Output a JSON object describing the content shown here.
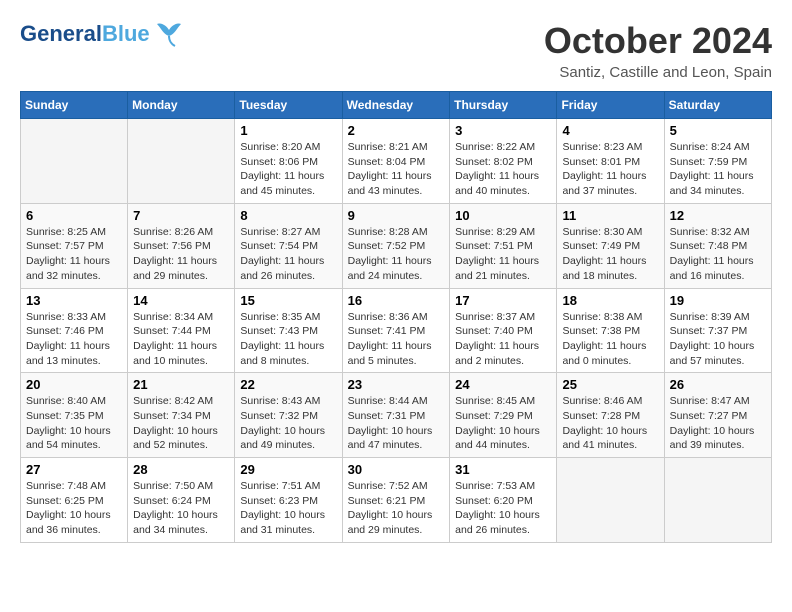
{
  "header": {
    "logo_line1": "General",
    "logo_line2": "Blue",
    "month_title": "October 2024",
    "subtitle": "Santiz, Castille and Leon, Spain"
  },
  "days_of_week": [
    "Sunday",
    "Monday",
    "Tuesday",
    "Wednesday",
    "Thursday",
    "Friday",
    "Saturday"
  ],
  "weeks": [
    [
      {
        "day": "",
        "info": ""
      },
      {
        "day": "",
        "info": ""
      },
      {
        "day": "1",
        "info": "Sunrise: 8:20 AM\nSunset: 8:06 PM\nDaylight: 11 hours and 45 minutes."
      },
      {
        "day": "2",
        "info": "Sunrise: 8:21 AM\nSunset: 8:04 PM\nDaylight: 11 hours and 43 minutes."
      },
      {
        "day": "3",
        "info": "Sunrise: 8:22 AM\nSunset: 8:02 PM\nDaylight: 11 hours and 40 minutes."
      },
      {
        "day": "4",
        "info": "Sunrise: 8:23 AM\nSunset: 8:01 PM\nDaylight: 11 hours and 37 minutes."
      },
      {
        "day": "5",
        "info": "Sunrise: 8:24 AM\nSunset: 7:59 PM\nDaylight: 11 hours and 34 minutes."
      }
    ],
    [
      {
        "day": "6",
        "info": "Sunrise: 8:25 AM\nSunset: 7:57 PM\nDaylight: 11 hours and 32 minutes."
      },
      {
        "day": "7",
        "info": "Sunrise: 8:26 AM\nSunset: 7:56 PM\nDaylight: 11 hours and 29 minutes."
      },
      {
        "day": "8",
        "info": "Sunrise: 8:27 AM\nSunset: 7:54 PM\nDaylight: 11 hours and 26 minutes."
      },
      {
        "day": "9",
        "info": "Sunrise: 8:28 AM\nSunset: 7:52 PM\nDaylight: 11 hours and 24 minutes."
      },
      {
        "day": "10",
        "info": "Sunrise: 8:29 AM\nSunset: 7:51 PM\nDaylight: 11 hours and 21 minutes."
      },
      {
        "day": "11",
        "info": "Sunrise: 8:30 AM\nSunset: 7:49 PM\nDaylight: 11 hours and 18 minutes."
      },
      {
        "day": "12",
        "info": "Sunrise: 8:32 AM\nSunset: 7:48 PM\nDaylight: 11 hours and 16 minutes."
      }
    ],
    [
      {
        "day": "13",
        "info": "Sunrise: 8:33 AM\nSunset: 7:46 PM\nDaylight: 11 hours and 13 minutes."
      },
      {
        "day": "14",
        "info": "Sunrise: 8:34 AM\nSunset: 7:44 PM\nDaylight: 11 hours and 10 minutes."
      },
      {
        "day": "15",
        "info": "Sunrise: 8:35 AM\nSunset: 7:43 PM\nDaylight: 11 hours and 8 minutes."
      },
      {
        "day": "16",
        "info": "Sunrise: 8:36 AM\nSunset: 7:41 PM\nDaylight: 11 hours and 5 minutes."
      },
      {
        "day": "17",
        "info": "Sunrise: 8:37 AM\nSunset: 7:40 PM\nDaylight: 11 hours and 2 minutes."
      },
      {
        "day": "18",
        "info": "Sunrise: 8:38 AM\nSunset: 7:38 PM\nDaylight: 11 hours and 0 minutes."
      },
      {
        "day": "19",
        "info": "Sunrise: 8:39 AM\nSunset: 7:37 PM\nDaylight: 10 hours and 57 minutes."
      }
    ],
    [
      {
        "day": "20",
        "info": "Sunrise: 8:40 AM\nSunset: 7:35 PM\nDaylight: 10 hours and 54 minutes."
      },
      {
        "day": "21",
        "info": "Sunrise: 8:42 AM\nSunset: 7:34 PM\nDaylight: 10 hours and 52 minutes."
      },
      {
        "day": "22",
        "info": "Sunrise: 8:43 AM\nSunset: 7:32 PM\nDaylight: 10 hours and 49 minutes."
      },
      {
        "day": "23",
        "info": "Sunrise: 8:44 AM\nSunset: 7:31 PM\nDaylight: 10 hours and 47 minutes."
      },
      {
        "day": "24",
        "info": "Sunrise: 8:45 AM\nSunset: 7:29 PM\nDaylight: 10 hours and 44 minutes."
      },
      {
        "day": "25",
        "info": "Sunrise: 8:46 AM\nSunset: 7:28 PM\nDaylight: 10 hours and 41 minutes."
      },
      {
        "day": "26",
        "info": "Sunrise: 8:47 AM\nSunset: 7:27 PM\nDaylight: 10 hours and 39 minutes."
      }
    ],
    [
      {
        "day": "27",
        "info": "Sunrise: 7:48 AM\nSunset: 6:25 PM\nDaylight: 10 hours and 36 minutes."
      },
      {
        "day": "28",
        "info": "Sunrise: 7:50 AM\nSunset: 6:24 PM\nDaylight: 10 hours and 34 minutes."
      },
      {
        "day": "29",
        "info": "Sunrise: 7:51 AM\nSunset: 6:23 PM\nDaylight: 10 hours and 31 minutes."
      },
      {
        "day": "30",
        "info": "Sunrise: 7:52 AM\nSunset: 6:21 PM\nDaylight: 10 hours and 29 minutes."
      },
      {
        "day": "31",
        "info": "Sunrise: 7:53 AM\nSunset: 6:20 PM\nDaylight: 10 hours and 26 minutes."
      },
      {
        "day": "",
        "info": ""
      },
      {
        "day": "",
        "info": ""
      }
    ]
  ]
}
